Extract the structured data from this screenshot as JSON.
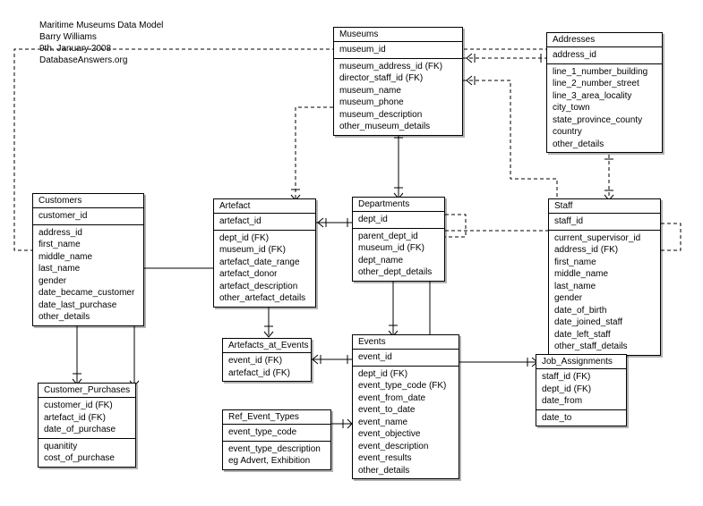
{
  "header": {
    "title": "Maritime Museums Data Model",
    "author": "Barry Williams",
    "date": "9th. January 2008",
    "site": "DatabaseAnswers.org"
  },
  "entities": {
    "museums": {
      "name": "Museums",
      "pk": "museum_id",
      "attrs": "museum_address_id (FK)\ndirector_staff_id (FK)\nmuseum_name\nmuseum_phone\nmuseum_description\nother_museum_details"
    },
    "addresses": {
      "name": "Addresses",
      "pk": "address_id",
      "attrs": "line_1_number_building\nline_2_number_street\nline_3_area_locality\ncity_town\nstate_province_county\ncountry\nother_details"
    },
    "customers": {
      "name": "Customers",
      "pk": "customer_id",
      "attrs": "address_id\nfirst_name\nmiddle_name\nlast_name\ngender\ndate_became_customer\ndate_last_purchase\nother_details"
    },
    "artefact": {
      "name": "Artefact",
      "pk": "artefact_id",
      "attrs": "dept_id (FK)\nmuseum_id (FK)\nartefact_date_range\nartefact_donor\nartefact_description\nother_artefact_details"
    },
    "departments": {
      "name": "Departments",
      "pk": "dept_id",
      "attrs": "parent_dept_id\nmuseum_id (FK)\ndept_name\nother_dept_details"
    },
    "staff": {
      "name": "Staff",
      "pk": "staff_id",
      "attrs": "current_supervisor_id\naddress_id (FK)\nfirst_name\nmiddle_name\nlast_name\ngender\ndate_of_birth\ndate_joined_staff\ndate_left_staff\nother_staff_details"
    },
    "artefacts_at_events": {
      "name": "Artefacts_at_Events",
      "pk": "event_id (FK)\nartefact_id (FK)"
    },
    "events": {
      "name": "Events",
      "pk": "event_id",
      "attrs": "dept_id (FK)\nevent_type_code (FK)\nevent_from_date\nevent_to_date\nevent_name\nevent_objective\nevent_description\nevent_results\nother_details"
    },
    "job_assignments": {
      "name": "Job_Assignments",
      "pk": "staff_id (FK)\ndept_id (FK)\ndate_from",
      "attrs": "date_to"
    },
    "customer_purchases": {
      "name": "Customer_Purchases",
      "pk": "customer_id (FK)\nartefact_id (FK)\ndate_of_purchase",
      "attrs": "quanitity\ncost_of_purchase"
    },
    "ref_event_types": {
      "name": "Ref_Event_Types",
      "pk": "event_type_code",
      "attrs": "event_type_description\neg Advert, Exhibition"
    }
  }
}
